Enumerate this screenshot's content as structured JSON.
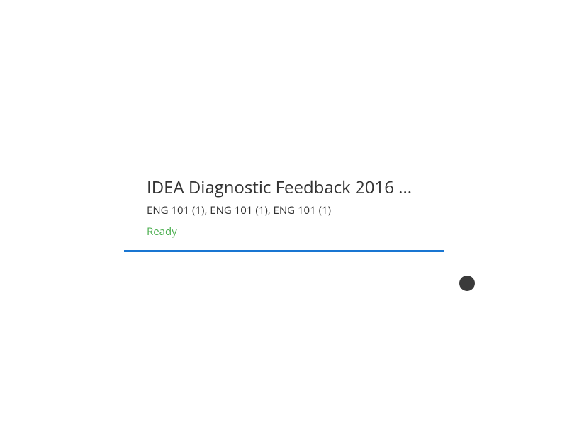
{
  "card": {
    "title": "IDEA Diagnostic Feedback 2016 ...",
    "subtitle": "ENG 101 (1), ENG 101 (1), ENG 101 (1)",
    "status": "Ready"
  },
  "colors": {
    "accent": "#1976d2",
    "status_ready": "#4caf50"
  }
}
